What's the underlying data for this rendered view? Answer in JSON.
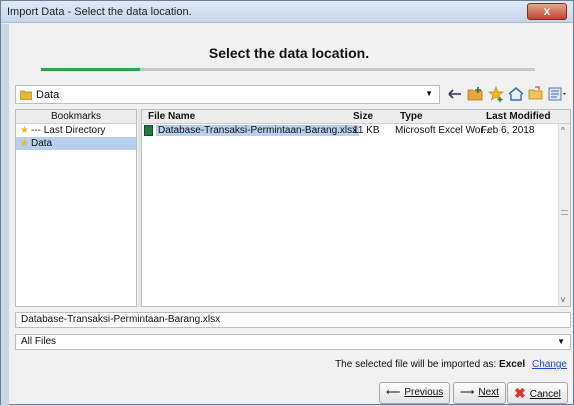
{
  "window": {
    "title": "Import Data - Select the data location.",
    "close_label": "x"
  },
  "header": {
    "title": "Select the data location."
  },
  "progress": {
    "fraction": 0.2
  },
  "location": {
    "value": "Data"
  },
  "toolbar": {
    "icons": [
      "back-arrow-icon",
      "new-folder-icon",
      "favorite-star-icon",
      "home-icon",
      "folder-open-icon",
      "view-menu-icon"
    ]
  },
  "bookmarks": {
    "header": "Bookmarks",
    "items": [
      {
        "label": "--- Last Directory",
        "selected": false
      },
      {
        "label": "Data",
        "selected": true
      }
    ]
  },
  "files": {
    "columns": {
      "name": "File Name",
      "size": "Size",
      "type": "Type",
      "modified": "Last Modified"
    },
    "rows": [
      {
        "name": "Database-Transaksi-Permintaan-Barang.xlsx",
        "size": "11 KB",
        "type": "Microsoft Excel Wor...",
        "modified": "Feb 6, 2018"
      }
    ]
  },
  "filename_field": {
    "value": "Database-Transaksi-Permintaan-Barang.xlsx"
  },
  "filter": {
    "value": "All Files"
  },
  "import_note": {
    "prefix": "The selected file will be imported as:",
    "format": "Excel",
    "change_link": "Change"
  },
  "buttons": {
    "previous": "Previous",
    "next": "Next",
    "cancel": "Cancel"
  }
}
